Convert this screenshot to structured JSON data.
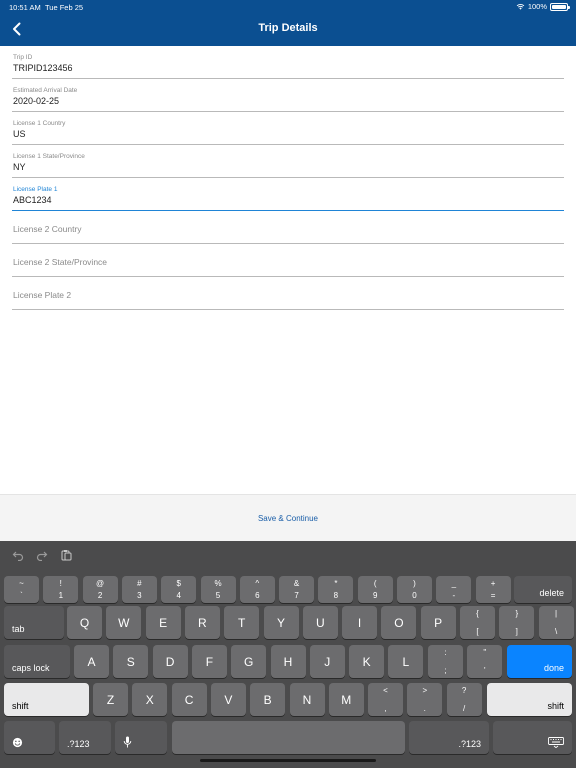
{
  "status": {
    "time": "10:51 AM",
    "date": "Tue Feb 25",
    "battery": "100%"
  },
  "nav": {
    "title": "Trip Details"
  },
  "fields": [
    {
      "label": "Trip ID",
      "value": "TRIPID123456"
    },
    {
      "label": "Estimated Arrival Date",
      "value": "2020-02-25"
    },
    {
      "label": "License 1 Country",
      "value": "US"
    },
    {
      "label": "License 1 State/Province",
      "value": "NY"
    },
    {
      "label": "License Plate 1",
      "value": "ABC1234"
    },
    {
      "placeholder": "License 2 Country"
    },
    {
      "placeholder": "License 2 State/Province"
    },
    {
      "placeholder": "License Plate 2"
    }
  ],
  "footer": {
    "save_label": "Save & Continue"
  },
  "colors": {
    "nav_bg": "#0b4f91",
    "accent": "#1f84d6",
    "done_key": "#0a84ff"
  },
  "keyboard": {
    "number_row": [
      {
        "top": "~",
        "bottom": "`"
      },
      {
        "top": "!",
        "bottom": "1"
      },
      {
        "top": "@",
        "bottom": "2"
      },
      {
        "top": "#",
        "bottom": "3"
      },
      {
        "top": "$",
        "bottom": "4"
      },
      {
        "top": "%",
        "bottom": "5"
      },
      {
        "top": "^",
        "bottom": "6"
      },
      {
        "top": "&",
        "bottom": "7"
      },
      {
        "top": "*",
        "bottom": "8"
      },
      {
        "top": "(",
        "bottom": "9"
      },
      {
        "top": ")",
        "bottom": "0"
      },
      {
        "top": "_",
        "bottom": "-"
      },
      {
        "top": "+",
        "bottom": "="
      }
    ],
    "delete": "delete",
    "tab": "tab",
    "row_q": [
      "Q",
      "W",
      "E",
      "R",
      "T",
      "Y",
      "U",
      "I",
      "O",
      "P"
    ],
    "row_q_extra": [
      {
        "top": "{",
        "bottom": "["
      },
      {
        "top": "}",
        "bottom": "]"
      },
      {
        "top": "|",
        "bottom": "\\"
      }
    ],
    "caps_lock": "caps lock",
    "row_a": [
      "A",
      "S",
      "D",
      "F",
      "G",
      "H",
      "J",
      "K",
      "L"
    ],
    "row_a_extra": [
      {
        "top": ":",
        "bottom": ";"
      },
      {
        "top": "\"",
        "bottom": "'"
      }
    ],
    "done": "done",
    "shift": "shift",
    "row_z": [
      "Z",
      "X",
      "C",
      "V",
      "B",
      "N",
      "M"
    ],
    "row_z_extra": [
      {
        "top": "<",
        "bottom": ","
      },
      {
        "top": ">",
        "bottom": "."
      },
      {
        "top": "?",
        "bottom": "/"
      }
    ],
    "numbers_toggle": ".?123"
  }
}
